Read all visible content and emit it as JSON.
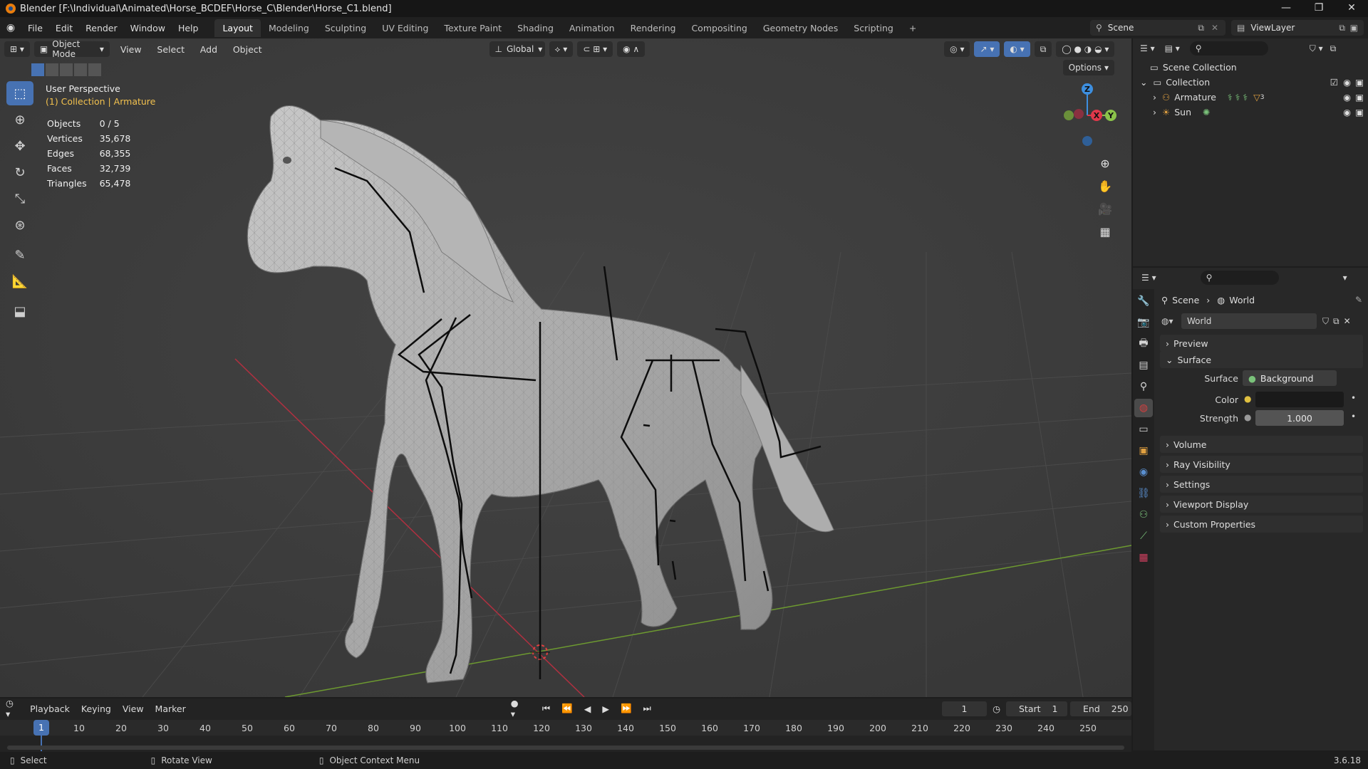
{
  "window": {
    "title": "Blender [F:\\Individual\\Animated\\Horse_BCDEF\\Horse_C\\Blender\\Horse_C1.blend]",
    "controls": [
      "—",
      "❐",
      "✕"
    ]
  },
  "menu": [
    "File",
    "Edit",
    "Render",
    "Window",
    "Help"
  ],
  "workspaces": [
    "Layout",
    "Modeling",
    "Sculpting",
    "UV Editing",
    "Texture Paint",
    "Shading",
    "Animation",
    "Rendering",
    "Compositing",
    "Geometry Nodes",
    "Scripting",
    "+"
  ],
  "active_workspace": "Layout",
  "scene_name": "Scene",
  "view_layer": "ViewLayer",
  "viewport": {
    "mode": "Object Mode",
    "menus": [
      "View",
      "Select",
      "Add",
      "Object"
    ],
    "transform_orientation": "Global",
    "options_label": "Options",
    "perspective": "User Perspective",
    "collection_info": "(1) Collection | Armature",
    "stats": [
      {
        "label": "Objects",
        "value": "0 / 5"
      },
      {
        "label": "Vertices",
        "value": "35,678"
      },
      {
        "label": "Edges",
        "value": "68,355"
      },
      {
        "label": "Faces",
        "value": "32,739"
      },
      {
        "label": "Triangles",
        "value": "65,478"
      }
    ],
    "gizmo_axes": [
      "Z",
      "X",
      "Y"
    ]
  },
  "timeline": {
    "menus": [
      "Playback",
      "Keying",
      "View",
      "Marker"
    ],
    "current_frame": "1",
    "start_label": "Start",
    "start": "1",
    "end_label": "End",
    "end": "250",
    "ticks": [
      "10",
      "20",
      "30",
      "40",
      "50",
      "60",
      "70",
      "80",
      "90",
      "100",
      "110",
      "120",
      "130",
      "140",
      "150",
      "160",
      "170",
      "180",
      "190",
      "200",
      "210",
      "220",
      "230",
      "240",
      "250"
    ]
  },
  "statusbar": {
    "items": [
      "Select",
      "Rotate View",
      "Object Context Menu"
    ],
    "version": "3.6.18"
  },
  "outliner": {
    "rows": [
      {
        "label": "Scene Collection"
      },
      {
        "label": "Collection"
      },
      {
        "label": "Armature",
        "extra": "3"
      },
      {
        "label": "Sun"
      }
    ]
  },
  "properties": {
    "breadcrumb_scene": "Scene",
    "breadcrumb_world": "World",
    "world_name": "World",
    "sections": [
      "Preview",
      "Surface",
      "Volume",
      "Ray Visibility",
      "Settings",
      "Viewport Display",
      "Custom Properties"
    ],
    "surface_label": "Surface",
    "surface_value": "Background",
    "color_label": "Color",
    "strength_label": "Strength",
    "strength_value": "1.000"
  },
  "colors": {
    "accent": "#4772b3",
    "x_axis": "#e0384a",
    "y_axis": "#8bc34a",
    "z_axis": "#3d8fe0",
    "collection_text": "#f2c14e"
  }
}
